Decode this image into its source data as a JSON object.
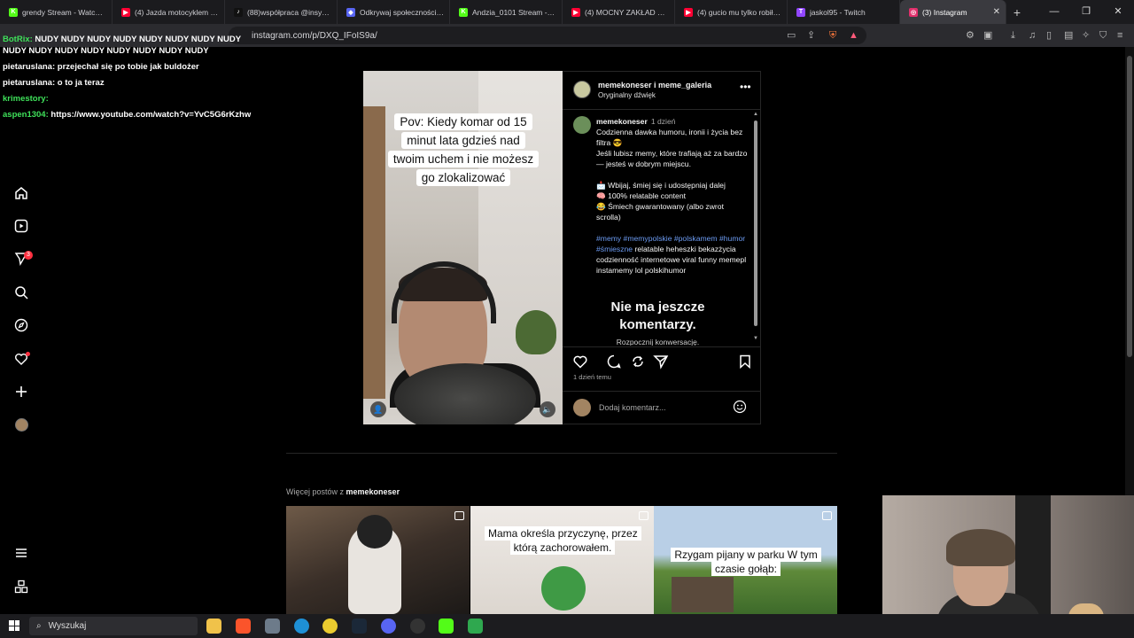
{
  "browser": {
    "tabs": [
      {
        "title": "grendy Stream - Watch Live",
        "color": "#53fc18",
        "glyph": "K"
      },
      {
        "title": "(4) Jazda motocyklem w ko",
        "color": "#ff0033",
        "glyph": "▶"
      },
      {
        "title": "(88)współpraca @insy @c",
        "color": "#111111",
        "glyph": "♪"
      },
      {
        "title": "Odkrywaj społeczności i p",
        "color": "#5865f2",
        "glyph": "◆"
      },
      {
        "title": "Andzia_0101 Stream - Wat",
        "color": "#53fc18",
        "glyph": "K"
      },
      {
        "title": "(4) MOCNY ZAKŁAD O BN",
        "color": "#ff0033",
        "glyph": "▶"
      },
      {
        "title": "(4) gucio mu tylko robił na",
        "color": "#ff0033",
        "glyph": "▶"
      },
      {
        "title": "jaskol95 - Twitch",
        "color": "#9146ff",
        "glyph": "T"
      },
      {
        "title": "(3) Instagram",
        "color": "#e1306c",
        "glyph": "◎",
        "active": true
      }
    ],
    "url": "instagram.com/p/DXQ_IFoIS9a/"
  },
  "chat": [
    {
      "user": "BotRix:",
      "color": "#3fe15a",
      "text": "NUDY   NUDY   NUDY   NUDY   NUDY   NUDY   NUDY   NUDY   NUDY   NUDY   NUDY   NUDY   NUDY   NUDY   NUDY   NUDY"
    },
    {
      "user": "pietaruslana:",
      "color": "#ffffff",
      "text": "przejechał się po tobie jak buldożer"
    },
    {
      "user": "pietaruslana:",
      "color": "#ffffff",
      "text": "o to ja teraz"
    },
    {
      "user": "krimestory:",
      "color": "#3fe15a",
      "text": ""
    },
    {
      "user": "aspen1304:",
      "color": "#3fe15a",
      "text": "https://www.youtube.com/watch?v=YvC5G6rKzhw"
    }
  ],
  "sidebar": {
    "notifications_badge": "3"
  },
  "post": {
    "caption_lines": [
      "Pov: Kiedy komar od 15",
      "minut lata gdzieś nad",
      "twoim uchem i nie możesz",
      "go zlokalizować"
    ],
    "header_user": "memekoneser i meme_galeria",
    "header_audio": "Oryginalny dźwięk",
    "comment_user": "memekoneser",
    "comment_time": "1 dzień",
    "comment_p1": "Codzienna dawka humoru, ironii i życia bez filtra 😎",
    "comment_p2": "Jeśli lubisz memy, które trafiają aż za bardzo — jesteś w dobrym miejscu.",
    "comment_b1": "📩 Wbijaj, śmiej się i udostępniaj dalej",
    "comment_b2": "🧠 100% relatable content",
    "comment_b3": "😂 Śmiech gwarantowany (albo zwrot scrolla)",
    "comment_tags": "#memy #memypolskie #polskamem #humor #śmieszne",
    "comment_tags_rest": " relatable heheszki bekazżycia codzienność internetowe viral funny memepl instamemy lol polskihumor",
    "no_comments": "Nie ma jeszcze komentarzy.",
    "start_conversation": "Rozpocznij konwersację.",
    "time_ago": "1 dzień temu",
    "add_comment_placeholder": "Dodaj komentarz..."
  },
  "more_posts": {
    "title_prefix": "Więcej postów z ",
    "title_user": "memekoneser",
    "items": [
      {
        "caption": ""
      },
      {
        "caption": "Mama określa przyczynę, przez którą zachorowałem."
      },
      {
        "caption": "Rzygam pijany w parku W tym czasie gołąb:"
      }
    ]
  },
  "taskbar": {
    "search_label": "Wyszukaj"
  }
}
